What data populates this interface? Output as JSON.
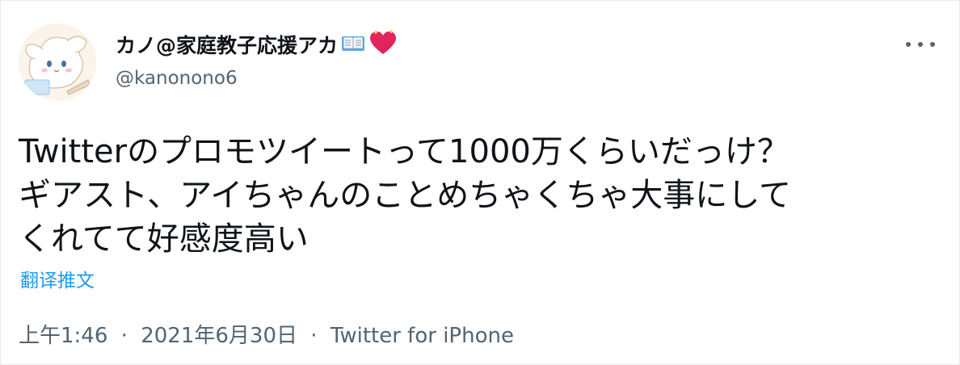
{
  "tweet": {
    "display_name": "カノ@家庭教子応援アカ",
    "name_emojis": [
      "book-icon",
      "sparkling-heart-icon"
    ],
    "handle": "@kanonono6",
    "text_lines": [
      "Twitterのプロモツイートって1000万くらいだっけ？",
      "ギアスト、アイちゃんのことめちゃくちゃ大事にして",
      "くれてて好感度高い"
    ],
    "translate_label": "翻译推文",
    "time": "上午1:46",
    "separator": "·",
    "date": "2021年6月30日",
    "source": "Twitter for iPhone"
  },
  "colors": {
    "text": "#0f1419",
    "secondary": "#536471",
    "link": "#1d9bf0",
    "heart": "#e0245e"
  }
}
